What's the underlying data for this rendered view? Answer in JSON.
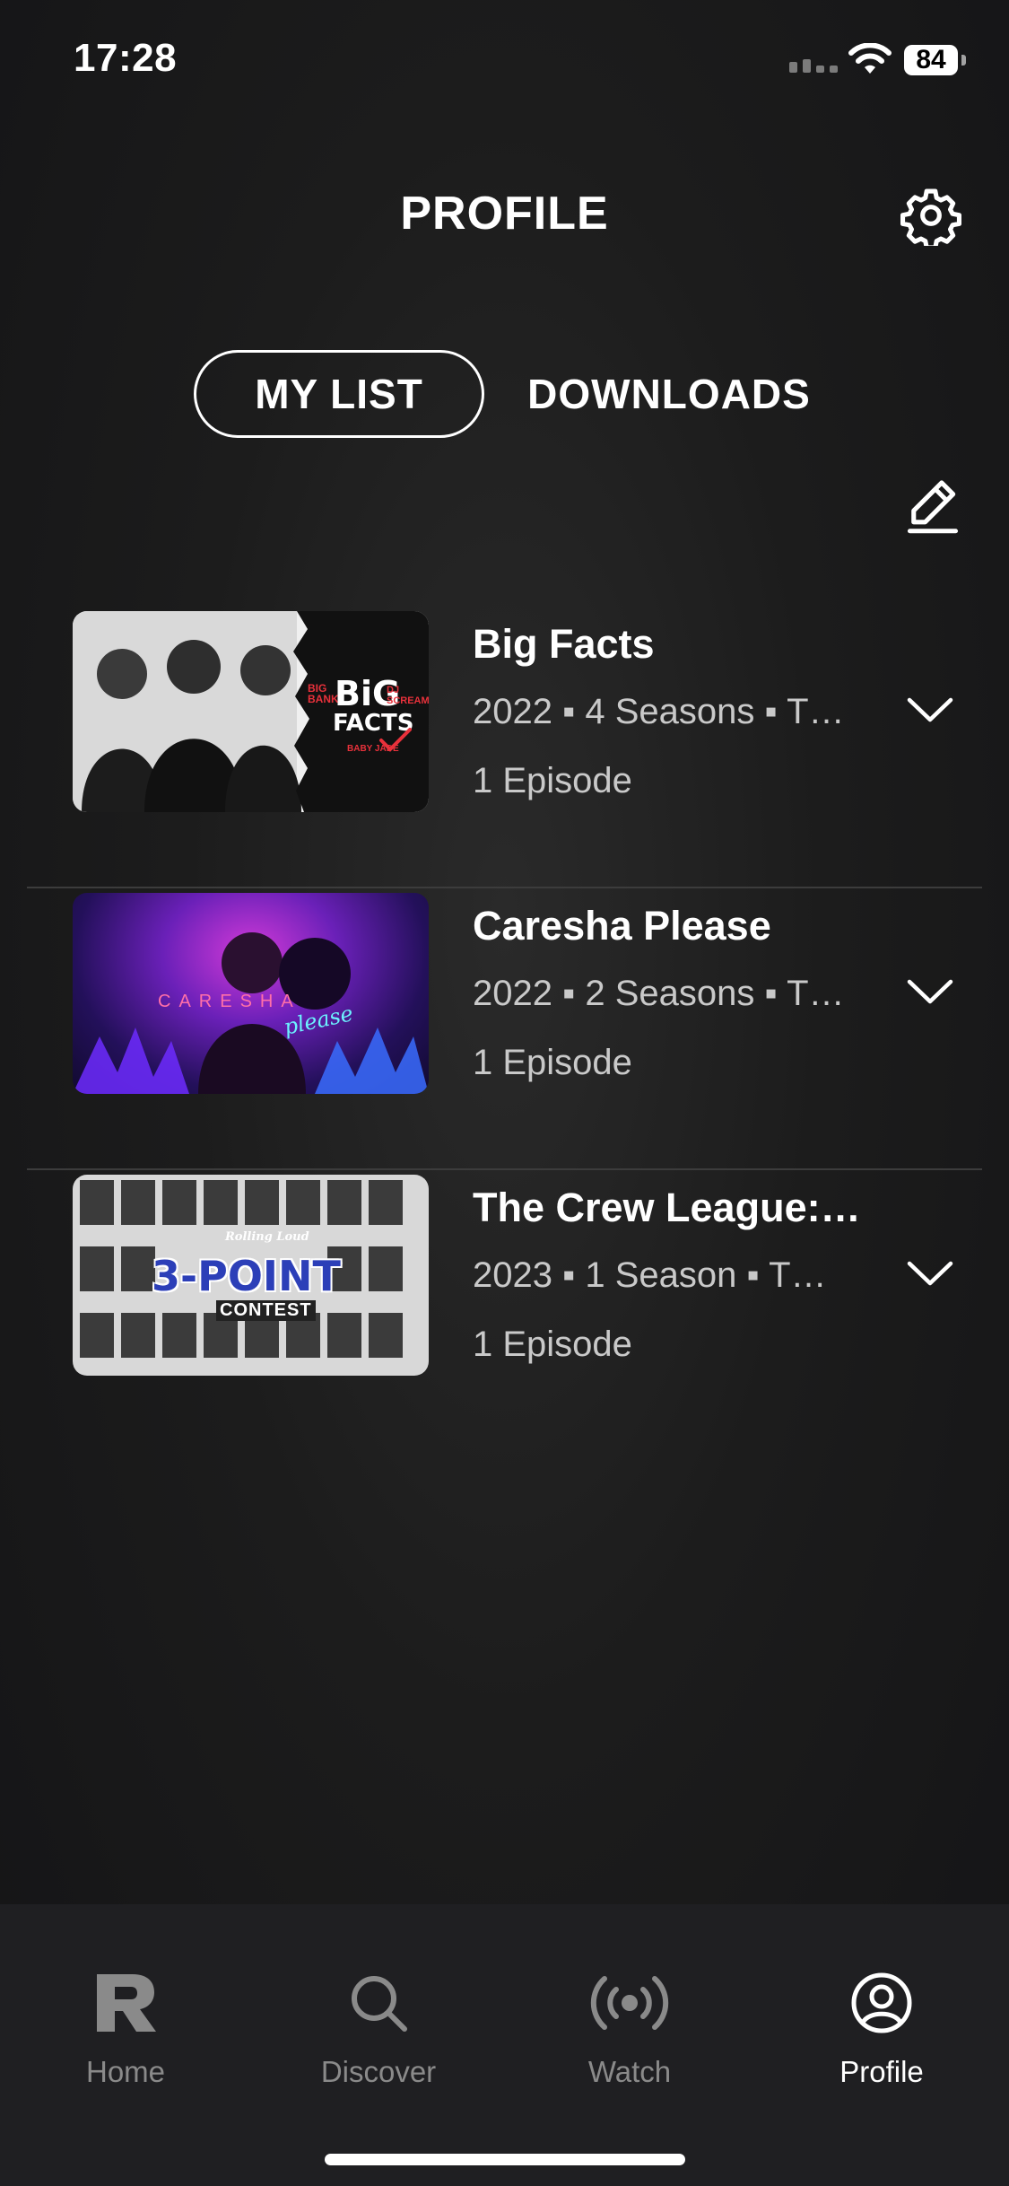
{
  "status_bar": {
    "time": "17:28",
    "battery": "84"
  },
  "header": {
    "title": "PROFILE"
  },
  "tabs": [
    {
      "label": "MY LIST",
      "active": true
    },
    {
      "label": "DOWNLOADS",
      "active": false
    }
  ],
  "list": [
    {
      "title": "Big Facts",
      "meta": "2022 ▪ 4 Seasons ▪ T…",
      "episodes": "1 Episode",
      "thumb_text": {
        "line1": "BiG",
        "line2": "FACTS",
        "left": "BIG BANK",
        "right": "DJ SCREAM",
        "small": "BABY JADE"
      }
    },
    {
      "title": "Caresha Please",
      "meta": "2022 ▪ 2 Seasons ▪ T…",
      "episodes": "1 Episode",
      "thumb_text": {
        "main": "CARESHA",
        "script": "please"
      }
    },
    {
      "title": "The Crew League:…",
      "meta": "2023 ▪ 1 Season ▪ T…",
      "episodes": "1 Episode",
      "thumb_text": {
        "top": "Rolling Loud",
        "main": "3-POINT",
        "bottom": "CONTEST"
      }
    }
  ],
  "bottom_nav": [
    {
      "label": "Home",
      "icon": "r-logo-icon",
      "active": false
    },
    {
      "label": "Discover",
      "icon": "search-icon",
      "active": false
    },
    {
      "label": "Watch",
      "icon": "broadcast-icon",
      "active": false
    },
    {
      "label": "Profile",
      "icon": "user-circle-icon",
      "active": true
    }
  ],
  "colors": {
    "background": "#1a1a1a",
    "nav_background": "#1f1f22",
    "inactive": "#8a8a8a",
    "text": "#ffffff",
    "secondary_text": "#c9c9c9"
  }
}
